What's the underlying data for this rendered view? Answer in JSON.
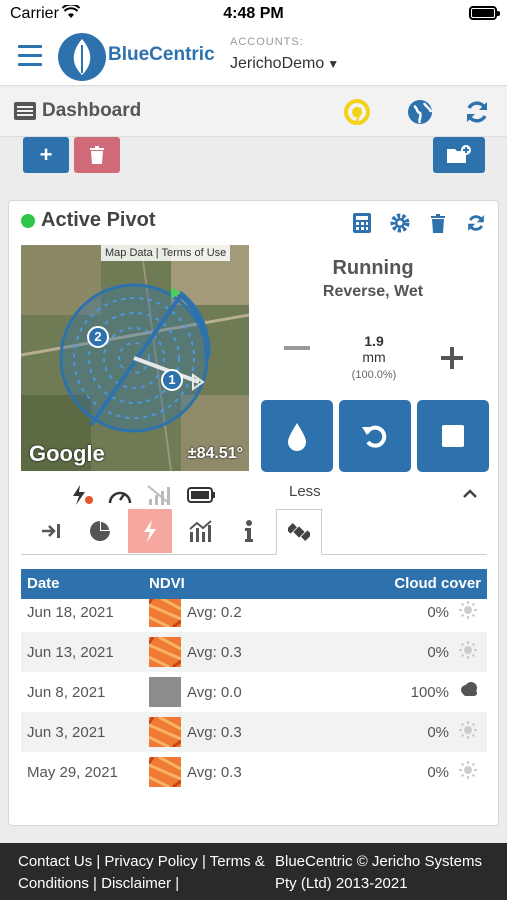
{
  "status_bar": {
    "carrier": "Carrier",
    "time": "4:48 PM"
  },
  "header": {
    "brand": "BlueCentric",
    "accounts_label": "ACCOUNTS:",
    "account_name": "JerichoDemo"
  },
  "dashboard": {
    "title": "Dashboard"
  },
  "card": {
    "title": "Active Pivot",
    "map": {
      "credit_data": "Map Data",
      "credit_terms": "Terms of Use",
      "provider": "Google",
      "angle": "±84.51°",
      "marker_1": "1",
      "marker_2": "2"
    },
    "state": "Running",
    "mode": "Reverse, Wet",
    "depth_value": "1.9",
    "depth_unit": "mm",
    "depth_percent": "(100.0%)",
    "less_label": "Less"
  },
  "table": {
    "headers": {
      "date": "Date",
      "ndvi": "NDVI",
      "cloud": "Cloud cover"
    },
    "rows": [
      {
        "date": "Jun 18, 2021",
        "avg": "Avg: 0.2",
        "cloud": "0%",
        "weather": "sun-icon"
      },
      {
        "date": "Jun 13, 2021",
        "avg": "Avg: 0.3",
        "cloud": "0%",
        "weather": "sun-icon"
      },
      {
        "date": "Jun 8, 2021",
        "avg": "Avg: 0.0",
        "cloud": "100%",
        "weather": "cloud-icon"
      },
      {
        "date": "Jun 3, 2021",
        "avg": "Avg: 0.3",
        "cloud": "0%",
        "weather": "sun-icon"
      },
      {
        "date": "May 29, 2021",
        "avg": "Avg: 0.3",
        "cloud": "0%",
        "weather": "sun-icon"
      }
    ]
  },
  "footer": {
    "links": "Contact Us | Privacy Policy | Terms & Conditions | Disclaimer |",
    "copyright": "BlueCentric © Jericho Systems Pty (Ltd) 2013-2021"
  },
  "colors": {
    "primary": "#2e72ad",
    "danger": "#d06a78",
    "active_dot": "#2ec64a",
    "active_tab": "#f6a8a0"
  }
}
